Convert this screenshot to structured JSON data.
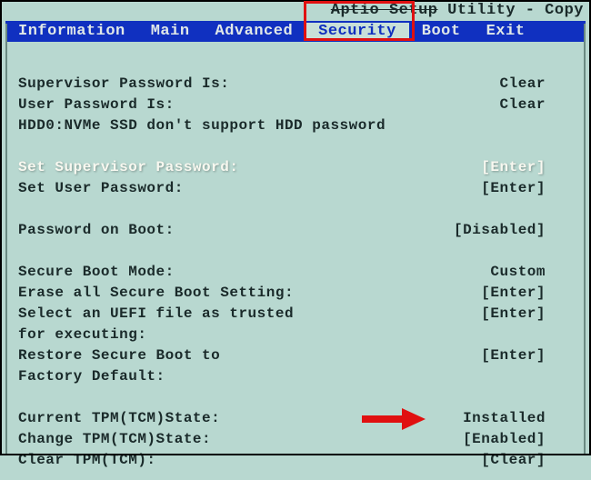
{
  "title": {
    "prefix": "Aptio Setup",
    "rest": " Utility - Copy"
  },
  "menu": {
    "items": [
      {
        "label": "Information"
      },
      {
        "label": "Main"
      },
      {
        "label": "Advanced"
      },
      {
        "label": "Security",
        "selected": true
      },
      {
        "label": "Boot"
      },
      {
        "label": "Exit"
      }
    ]
  },
  "body": {
    "supervisor_pw_label": "Supervisor Password Is:",
    "supervisor_pw_value": "Clear",
    "user_pw_label": "User Password Is:",
    "user_pw_value": "Clear",
    "hdd0_line": "HDD0:NVMe SSD don't support HDD password",
    "set_supervisor_label": "Set Supervisor Password:",
    "set_supervisor_value": "[Enter]",
    "set_user_label": "Set User Password:",
    "set_user_value": "[Enter]",
    "pw_on_boot_label": "Password on Boot:",
    "pw_on_boot_value": "[Disabled]",
    "secure_boot_mode_label": "Secure Boot Mode:",
    "secure_boot_mode_value": "Custom",
    "erase_secure_label": "Erase all Secure Boot Setting:",
    "erase_secure_value": "[Enter]",
    "select_uefi_label1": "Select an UEFI file as trusted",
    "select_uefi_label2": "for executing:",
    "select_uefi_value": "[Enter]",
    "restore_secure_label1": "Restore Secure Boot to",
    "restore_secure_label2": "Factory Default:",
    "restore_secure_value": "[Enter]",
    "current_tpm_label": "Current TPM(TCM)State:",
    "current_tpm_value": "Installed",
    "change_tpm_label": "Change TPM(TCM)State:",
    "change_tpm_value": "[Enabled]",
    "clear_tpm_label": "Clear TPM(TCM):",
    "clear_tpm_value": "[Clear]"
  }
}
